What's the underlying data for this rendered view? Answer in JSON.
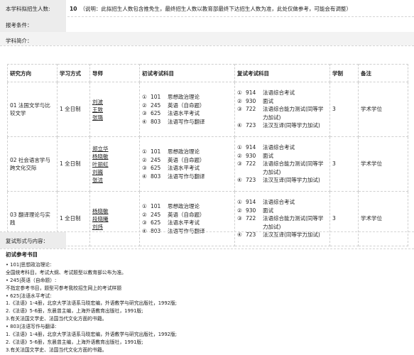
{
  "quota": {
    "label": "本学科拟招生人数:",
    "count": "10",
    "note": "（说明：此拟招生人数包含推免生，最终招生人数以教育部最终下达招生人数为准，此处仅做参考，可能会有调整）"
  },
  "conditions": {
    "label": "报考条件：",
    "value": ""
  },
  "intro": {
    "label": "学科简介："
  },
  "table": {
    "headers": [
      "研究方向",
      "学习方式",
      "导师",
      "初试考试科目",
      "复试考试科目",
      "学制",
      "备注"
    ],
    "rows": [
      {
        "direction": "01 法国文学与比较文学",
        "mode": "1 全日制",
        "tutors": [
          "刘波",
          "王致",
          "张璐"
        ],
        "initial": [
          {
            "n": "①",
            "code": "101",
            "name": "思想政治理论"
          },
          {
            "n": "②",
            "code": "245",
            "name": "英语（自命题）"
          },
          {
            "n": "③",
            "code": "625",
            "name": "法语水平考试"
          },
          {
            "n": "④",
            "code": "803",
            "name": "法语写作与翻译"
          }
        ],
        "retest": [
          {
            "n": "①",
            "code": "914",
            "name": "法语综合考试"
          },
          {
            "n": "②",
            "code": "930",
            "name": "面试"
          },
          {
            "n": "③",
            "code": "722",
            "name": "法语综合能力测试(同等学力加试)"
          },
          {
            "n": "④",
            "code": "723",
            "name": "法汉互译(同等学力加试)"
          }
        ],
        "years": "3",
        "remark": "学术学位"
      },
      {
        "direction": "02 社会语言学与跨文化交际",
        "mode": "1 全日制",
        "tutors": [
          "郑立华",
          "杨晓敏",
          "叶丽虹",
          "刘巍",
          "张洁"
        ],
        "initial": [
          {
            "n": "①",
            "code": "101",
            "name": "思想政治理论"
          },
          {
            "n": "②",
            "code": "245",
            "name": "英语（自命题）"
          },
          {
            "n": "③",
            "code": "625",
            "name": "法语水平考试"
          },
          {
            "n": "④",
            "code": "803",
            "name": "法语写作与翻译"
          }
        ],
        "retest": [
          {
            "n": "①",
            "code": "914",
            "name": "法语综合考试"
          },
          {
            "n": "②",
            "code": "930",
            "name": "面试"
          },
          {
            "n": "③",
            "code": "722",
            "name": "法语综合能力测试(同等学力加试)"
          },
          {
            "n": "④",
            "code": "723",
            "name": "法汉互译(同等学力加试)"
          }
        ],
        "years": "3",
        "remark": "学术学位"
      },
      {
        "direction": "03 翻译理论与实践",
        "mode": "1 全日制",
        "tutors": [
          "杨晓敏",
          "段晓曦",
          "刘炜"
        ],
        "initial": [
          {
            "n": "①",
            "code": "101",
            "name": "思想政治理论"
          },
          {
            "n": "②",
            "code": "245",
            "name": "英语（自命题）"
          },
          {
            "n": "③",
            "code": "625",
            "name": "法语水平考试"
          },
          {
            "n": "④",
            "code": "803",
            "name": "法语写作与翻译"
          }
        ],
        "retest": [
          {
            "n": "①",
            "code": "914",
            "name": "法语综合考试"
          },
          {
            "n": "②",
            "code": "930",
            "name": "面试"
          },
          {
            "n": "③",
            "code": "722",
            "name": "法语综合能力测试(同等学力加试)"
          },
          {
            "n": "④",
            "code": "723",
            "name": "法汉互译(同等学力加试)"
          }
        ],
        "years": "3",
        "remark": "学术学位"
      }
    ]
  },
  "retest_form": {
    "label": "复试形式与内容：",
    "value": ""
  },
  "references": {
    "heading": "初试参考书目",
    "lines": [
      {
        "text": "• 101|思想政治理论:",
        "sub": false
      },
      {
        "text": "全国统考科目，考试大纲、考试题型以教育部公布为准。",
        "sub": true
      },
      {
        "text": "• 245|英语（自命题）:",
        "sub": false
      },
      {
        "text": "不指定参考书目，题型可参考我校招生网上的考试样题",
        "sub": true
      },
      {
        "text": "• 625|法语水平考试:",
        "sub": false
      },
      {
        "text": "1.《法语》1-4册，北京大学法语系马晓宏编，外语教学与研究出版社，1992版;",
        "sub": true
      },
      {
        "text": "2.《法语》5-6册，东晨曾主编，上海外语教育出版社，1991版;",
        "sub": true
      },
      {
        "text": "3.有关法国文学史、法国当代文化方面的书籍。",
        "sub": true
      },
      {
        "text": "• 803|法语写作与翻译:",
        "sub": false
      },
      {
        "text": "1.《法语》1-4册，北京大学法语系马晓宏编，外语教学与研究出版社，1992版;",
        "sub": true
      },
      {
        "text": "2.《法语》5-6册，东晨曾主编，上海外语教育出版社，1991版;",
        "sub": true
      },
      {
        "text": "3.有关法国文学史、法国当代文化方面的书籍。",
        "sub": true
      }
    ]
  }
}
